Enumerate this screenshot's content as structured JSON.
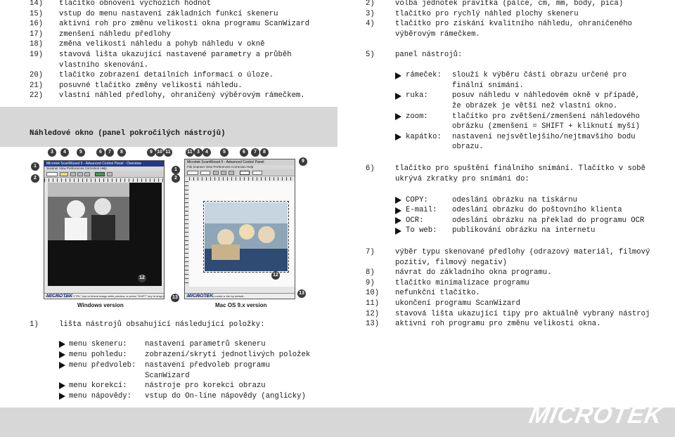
{
  "left_top_items": [
    {
      "num": "14)",
      "text": "tlačítko obnovení výchozích hodnot"
    },
    {
      "num": "15)",
      "text": "vstup do menu nastavení základních funkcí skeneru"
    },
    {
      "num": "16)",
      "text": "aktivní roh pro změnu velikosti okna programu ScanWizard"
    },
    {
      "num": "17)",
      "text": "zmenšení náhledu předlohy"
    },
    {
      "num": "18)",
      "text": "změna velikosti náhledu a pohyb náhledu v okně"
    },
    {
      "num": "19)",
      "text": "stavová lišta ukazující nastavené parametry a průběh"
    },
    {
      "num": "",
      "text": "vlastního skenování."
    },
    {
      "num": "20)",
      "text": "tlačítko zobrazení detailních informací o úloze."
    },
    {
      "num": "21)",
      "text": "posuvné tlačítko změny velikosti náhledu."
    },
    {
      "num": "22)",
      "text": "vlastní náhled předlohy, ohraničený výběrovým rámečkem."
    }
  ],
  "section_title": "Náhledové okno (panel pokročilých nástrojů)",
  "figure": {
    "windows_label": "Windows version",
    "mac_label": "Mac OS 9.x version",
    "windows_title": "Microtek ScanWizard 5 - Advanced Control Panel - Overview",
    "mac_title": "Microtek ScanWizard 5 - Advanced Control Panel",
    "windows_menu": "Scanner  View  Preferences  Correction  Help",
    "mac_menu": "File  Scanner  View  Preferences  Correction  Help",
    "windows_status": "Help  Preview . press \"CTRL\" key to freeze image while preview, or press \"SHIFT\" key to drag bounding box",
    "mac_status": "Info  \"SAMPLE.ZIP\" To create a Job by default...",
    "mini_logo": "MICROTEK",
    "callouts_top_left": [
      "3",
      "4",
      "5",
      "6",
      "7",
      "8",
      "9",
      "10",
      "11"
    ],
    "callouts_top_right": [
      "11",
      "3",
      "4",
      "5",
      "6",
      "7",
      "8"
    ],
    "callouts_side": [
      "1",
      "2"
    ],
    "callout_9_right": "9",
    "callout_12": "12",
    "callout_13": "13"
  },
  "bottom_left": {
    "item_num": "1)",
    "item_text": "lišta nástrojů obsahující následující položky:",
    "bullets": [
      {
        "label": "menu skeneru:",
        "desc": [
          "nastavení parametrů skeneru"
        ]
      },
      {
        "label": "menu pohledu:",
        "desc": [
          "zobrazení/skrytí jednotlivých položek"
        ]
      },
      {
        "label": "menu předvoleb:",
        "desc": [
          "nastavení předvoleb programu",
          "ScanWizard"
        ]
      },
      {
        "label": "menu korekcí:",
        "desc": [
          "nástroje pro korekci obrazu"
        ]
      },
      {
        "label": "menu nápovědy:",
        "desc": [
          "vstup do On-line nápovědy (anglicky)"
        ]
      }
    ]
  },
  "right_top_items": [
    {
      "num": "2)",
      "text": [
        "volba jednotek pravítka (palce, cm, mm, body, pica)"
      ]
    },
    {
      "num": "3)",
      "text": [
        "tlačítko pro rychlý náhled plochy skeneru"
      ]
    },
    {
      "num": "4)",
      "text": [
        "tlačítko pro získání kvalitního náhledu, ohraničeného",
        "výběrovým rámečkem."
      ]
    },
    {
      "num": "5)",
      "text": [
        "panel nástrojů:"
      ]
    }
  ],
  "tools": [
    {
      "label": "rámeček:",
      "desc": [
        "slouží k výběru části obrazu určené pro",
        "finální snímání."
      ]
    },
    {
      "label": "ruka:",
      "desc": [
        "posuv náhledu v náhledovém okně v případě,",
        "že obrázek je větší než vlastní okno."
      ]
    },
    {
      "label": "zoom:",
      "desc": [
        "tlačítko pro zvětšení/zmenšení náhledového",
        "obrázku (zmenšení = SHIFT + kliknutí myší)"
      ]
    },
    {
      "label": "kapátko:",
      "desc": [
        "nastavení nejsvětlejšího/nejtmavšího bodu",
        "obrazu."
      ]
    }
  ],
  "item6": {
    "num": "6)",
    "text": [
      "tlačítko pro spuštění finálního snímání. Tlačítko v sobě",
      "ukrývá zkratky pro snímání do:"
    ]
  },
  "shortcuts": [
    {
      "label": "COPY:",
      "desc": "odeslání obrázku na tiskárnu"
    },
    {
      "label": "E-mail:",
      "desc": "odeslání obrázku do poštovního klienta"
    },
    {
      "label": "OCR:",
      "desc": "odeslání obrázku na překlad do programu OCR"
    },
    {
      "label": "To web:",
      "desc": "publikování obrázku na internetu"
    }
  ],
  "right_bottom_items": [
    {
      "num": "7)",
      "text": [
        "výběr typu skenované předlohy (odrazový materiál, filmový",
        "pozitiv, filmový negativ)"
      ]
    },
    {
      "num": "8)",
      "text": [
        "návrat do základního okna programu."
      ]
    },
    {
      "num": "9)",
      "text": [
        "tlačítko minimalizace programu"
      ]
    },
    {
      "num": "10)",
      "text": [
        "nefunkční tlačítko."
      ]
    },
    {
      "num": "11)",
      "text": [
        "ukončení programu ScanWizard"
      ]
    },
    {
      "num": "12)",
      "text": [
        "stavová lišta ukazující tipy pro aktuálně vybraný nástroj"
      ]
    },
    {
      "num": "13)",
      "text": [
        "aktivní roh programu pro změnu velikosti okna."
      ]
    }
  ],
  "footer": {
    "logo": "MICROTEK"
  }
}
